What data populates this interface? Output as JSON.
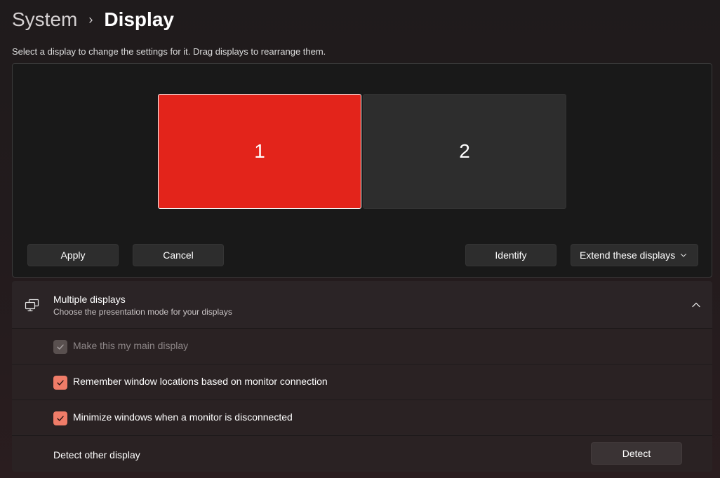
{
  "breadcrumb": {
    "parent": "System",
    "separator": "›",
    "current": "Display"
  },
  "subtitle": "Select a display to change the settings for it. Drag displays to rearrange them.",
  "arrangement": {
    "monitors": [
      {
        "label": "1",
        "selected": true,
        "color": "#e3241b"
      },
      {
        "label": "2",
        "selected": false,
        "color": "#2d2d2d"
      }
    ],
    "buttons": {
      "apply": "Apply",
      "cancel": "Cancel",
      "identify": "Identify"
    },
    "mode_select": {
      "value": "Extend these displays",
      "icon": "chevron-down-icon"
    }
  },
  "multiple_displays": {
    "icon": "multiple-displays-icon",
    "title": "Multiple displays",
    "description": "Choose the presentation mode for your displays",
    "expanded": true,
    "options": [
      {
        "label": "Make this my main display",
        "checked": true,
        "disabled": true
      },
      {
        "label": "Remember window locations based on monitor connection",
        "checked": true,
        "disabled": false
      },
      {
        "label": "Minimize windows when a monitor is disconnected",
        "checked": true,
        "disabled": false
      }
    ],
    "detect": {
      "label": "Detect other display",
      "button": "Detect"
    }
  },
  "colors": {
    "accent": "#ef7c68",
    "selected_monitor": "#e3241b"
  }
}
